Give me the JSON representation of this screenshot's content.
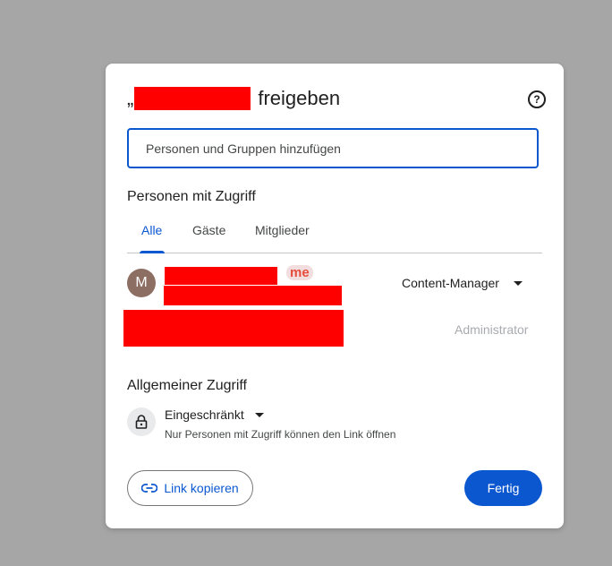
{
  "dialog": {
    "title_prefix": "„",
    "title_suffix": "freigeben",
    "help_icon": "?",
    "input_placeholder": "Personen und Gruppen hinzufügen",
    "section_access": "Personen mit Zugriff",
    "tabs": [
      {
        "label": "Alle",
        "active": true
      },
      {
        "label": "Gäste",
        "active": false
      },
      {
        "label": "Mitglieder",
        "active": false
      }
    ],
    "people": [
      {
        "avatar_letter": "M",
        "badge": "me",
        "role": "Content-Manager"
      },
      {
        "role": "Administrator"
      }
    ],
    "section_general": "Allgemeiner Zugriff",
    "general_access": {
      "icon": "lock-icon",
      "name": "Eingeschränkt",
      "description": "Nur Personen mit Zugriff können den Link öffnen"
    },
    "copy_link_label": "Link kopieren",
    "done_label": "Fertig"
  },
  "colors": {
    "accent": "#0b57d0",
    "avatar": "#8d6e63",
    "redaction": "#ff0000"
  }
}
